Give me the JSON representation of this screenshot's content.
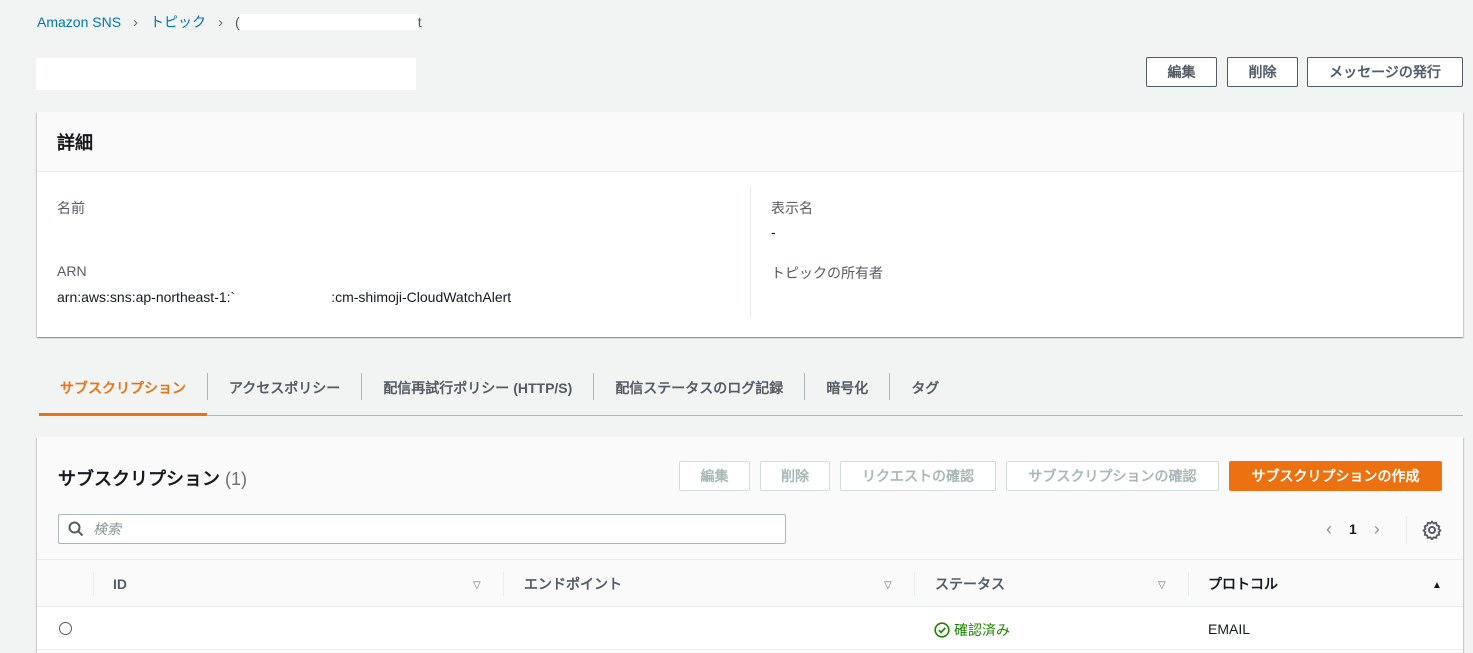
{
  "breadcrumb": {
    "service": "Amazon SNS",
    "topics": "トピック",
    "current_prefix": "(",
    "current_suffix": "t"
  },
  "header_buttons": {
    "edit": "編集",
    "delete": "削除",
    "publish": "メッセージの発行"
  },
  "details": {
    "title": "詳細",
    "name_label": "名前",
    "name_value": "",
    "arn_label": "ARN",
    "arn_prefix": "arn:aws:sns:ap-northeast-1:`",
    "arn_suffix": ":cm-shimoji-CloudWatchAlert",
    "display_name_label": "表示名",
    "display_name_value": "-",
    "owner_label": "トピックの所有者",
    "owner_value": ""
  },
  "tabs": [
    {
      "label": "サブスクリプション",
      "active": true
    },
    {
      "label": "アクセスポリシー",
      "active": false
    },
    {
      "label": "配信再試行ポリシー (HTTP/S)",
      "active": false
    },
    {
      "label": "配信ステータスのログ記録",
      "active": false
    },
    {
      "label": "暗号化",
      "active": false
    },
    {
      "label": "タグ",
      "active": false
    }
  ],
  "subscriptions": {
    "title": "サブスクリプション",
    "count": "(1)",
    "buttons": {
      "edit": "編集",
      "delete": "削除",
      "request_confirm": "リクエストの確認",
      "confirm_subscription": "サブスクリプションの確認",
      "create": "サブスクリプションの作成"
    },
    "search_placeholder": "検索",
    "page": "1",
    "columns": {
      "id": "ID",
      "endpoint": "エンドポイント",
      "status": "ステータス",
      "protocol": "プロトコル"
    },
    "rows": [
      {
        "id": "",
        "endpoint": "",
        "status": "確認済み",
        "protocol": "EMAIL"
      }
    ]
  },
  "colors": {
    "accent": "#ec7211",
    "link": "#0073bb",
    "success": "#1d8102"
  },
  "icons": [
    "search-icon",
    "settings-icon",
    "chevron-left-icon",
    "chevron-right-icon",
    "sort-down-icon",
    "sort-up-icon",
    "check-circle-icon"
  ]
}
